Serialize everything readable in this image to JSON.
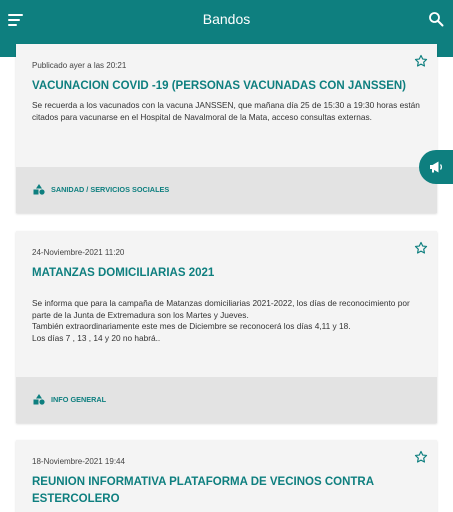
{
  "app_bar": {
    "title": "Bandos",
    "menu_icon": "menu-icon",
    "search_icon": "search-icon"
  },
  "bandos": [
    {
      "date": "Publicado ayer a las 20:21",
      "title": "VACUNACION COVID -19  (PERSONAS VACUNADAS CON JANSSEN)",
      "body": "Se recuerda a los vacunados con la vacuna JANSSEN, que mañana día 25  de 15:30 a 19:30 horas están citados para vacunarse en el Hospital de Navalmoral de la Mata, acceso consultas externas.",
      "category": "SANIDAD / SERVICIOS SOCIALES"
    },
    {
      "date": "24-Noviembre-2021 11:20",
      "title": "MATANZAS DOMICILIARIAS 2021",
      "body": "Se informa que para la campaña de Matanzas domiciliarias 2021-2022,  los días de reconocimiento  por parte de la Junta de Extremadura son los Martes y Jueves.\nTambién extraordinariamente este mes de Diciembre se reconocerá los días 4,11 y 18.\nLos días 7 , 13 , 14 y 20 no habrá..",
      "category": "INFO GENERAL"
    },
    {
      "date": "18-Noviembre-2021 19:44",
      "title": "REUNION INFORMATIVA PLATAFORMA DE VECINOS CONTRA ESTERCOLERO",
      "body": "",
      "category": ""
    }
  ],
  "colors": {
    "primary": "#0e7f7f",
    "card_bg": "#f4f4f4",
    "footer_bg": "#e3e3e3"
  },
  "fab_icon": "megaphone-icon"
}
